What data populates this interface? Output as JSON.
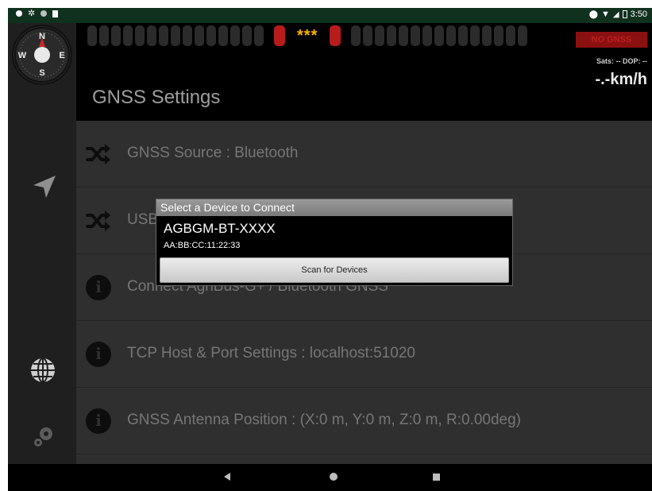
{
  "status_bar": {
    "time": "3:50"
  },
  "header": {
    "stars": "***",
    "gnss_status": "NO GNSS",
    "sats": "Sats: --  DOP: --",
    "speed": "-.-km/h",
    "title": "GNSS Settings"
  },
  "settings": {
    "items": [
      {
        "label": "GNSS Source : Bluetooth",
        "icon": "shuffle-icon"
      },
      {
        "label": "USB",
        "icon": "shuffle-icon"
      },
      {
        "label": "Connect AgriBus-G+ / Bluetooth GNSS",
        "icon": "info-icon"
      },
      {
        "label": "TCP Host & Port Settings : localhost:51020",
        "icon": "info-icon"
      },
      {
        "label": "GNSS Antenna Position : (X:0 m, Y:0 m, Z:0 m, R:0.00deg)",
        "icon": "info-icon"
      }
    ]
  },
  "dialog": {
    "title": "Select a Device to Connect",
    "device_name": "AGBGM-BT-XXXX",
    "device_address": "AA:BB:CC:11:22:33",
    "scan_button": "Scan for Devices"
  },
  "compass": {
    "n": "N",
    "s": "S",
    "w": "W",
    "e": "E"
  },
  "colors": {
    "status_bar": "#11311f",
    "led_red": "#b71c1c",
    "stars": "#ffb300",
    "no_gnss_bg": "#8b1010"
  }
}
